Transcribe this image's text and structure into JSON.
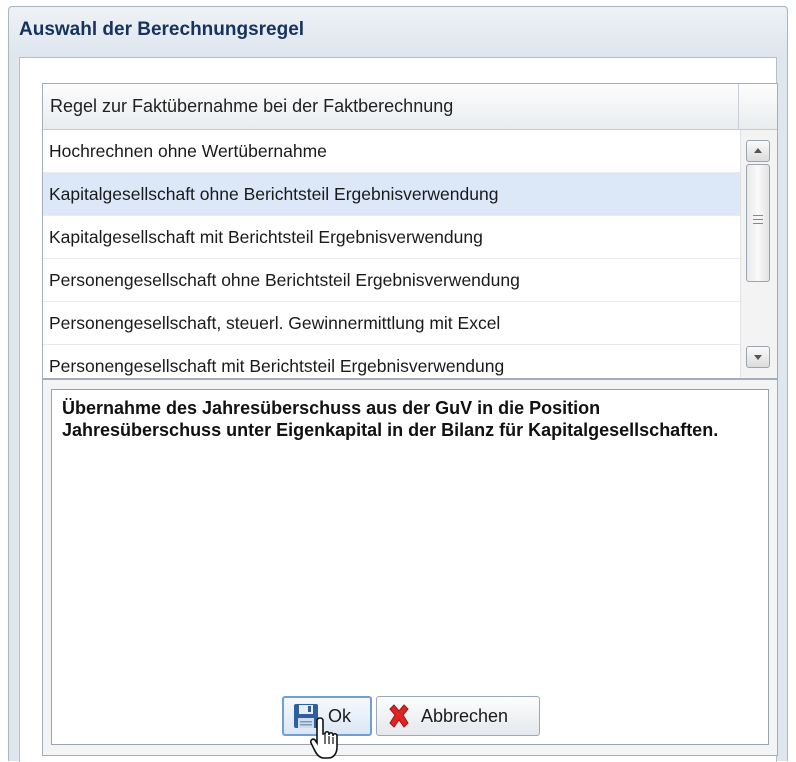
{
  "dialog": {
    "title": "Auswahl der Berechnungsregel"
  },
  "grid": {
    "column_header": "Regel zur Faktübernahme bei der Faktberechnung",
    "rows": [
      {
        "label": "Hochrechnen ohne Wertübernahme",
        "selected": false
      },
      {
        "label": "Kapitalgesellschaft ohne Berichtsteil Ergebnisverwendung",
        "selected": true
      },
      {
        "label": "Kapitalgesellschaft mit Berichtsteil Ergebnisverwendung",
        "selected": false
      },
      {
        "label": "Personengesellschaft ohne Berichtsteil Ergebnisverwendung",
        "selected": false
      },
      {
        "label": "Personengesellschaft, steuerl. Gewinnermittlung mit Excel",
        "selected": false
      },
      {
        "label": "Personengesellschaft mit Berichtsteil Ergebnisverwendung",
        "selected": false
      }
    ]
  },
  "description": {
    "text": "Übernahme des Jahresüberschuss aus der GuV in die Position Jahresüberschuss unter Eigenkapital in der Bilanz für Kapitalgesellschaften."
  },
  "buttons": {
    "ok": {
      "label": "Ok",
      "icon": "floppy-disk-icon"
    },
    "cancel": {
      "label": "Abbrechen",
      "icon": "red-x-icon"
    }
  },
  "colors": {
    "selected_row": "#dce8f8",
    "title_text": "#15335d",
    "cancel_icon": "#e02424",
    "save_icon": "#2f5f9e"
  }
}
